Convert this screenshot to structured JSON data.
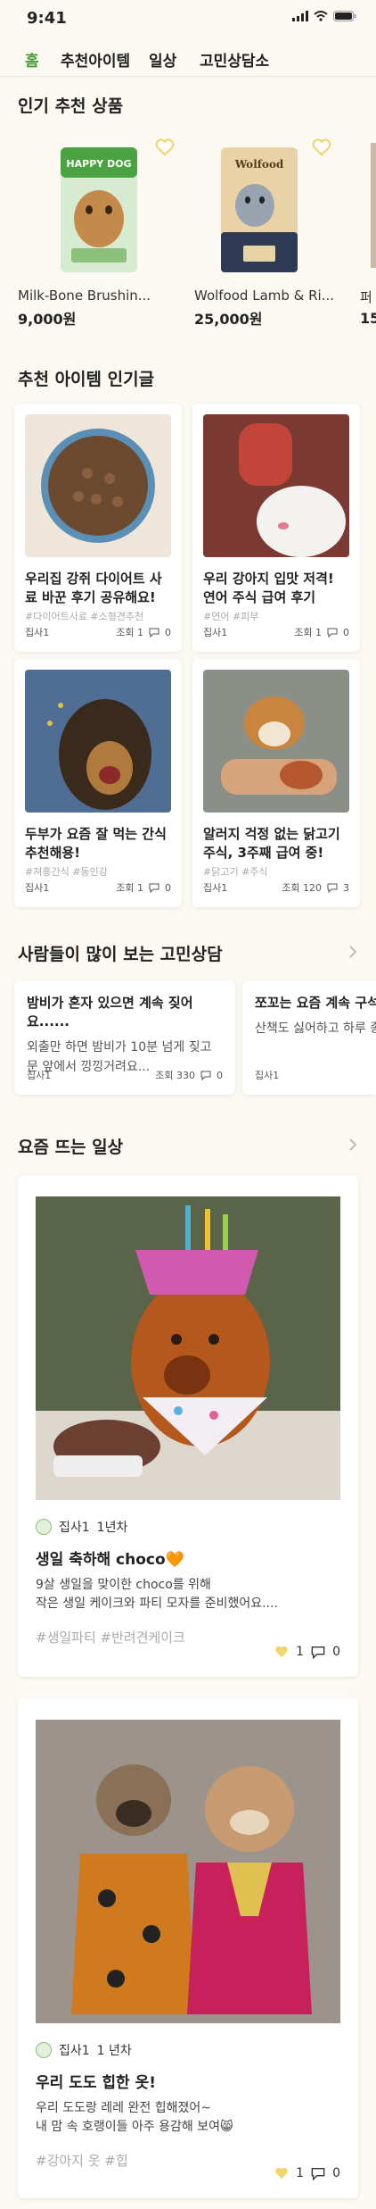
{
  "status_bar": {
    "time": "9:41"
  },
  "nav": {
    "tabs": [
      {
        "label": "홈",
        "active": true
      },
      {
        "label": "추천아이템",
        "active": false
      },
      {
        "label": "일상",
        "active": false
      },
      {
        "label": "고민상담소",
        "active": false
      }
    ]
  },
  "popular": {
    "title": "인기 추천 상품",
    "products": [
      {
        "name": "Milk-Bone Brushin...",
        "price": "9,000원",
        "img_text": "HAPPY DOG"
      },
      {
        "name": "Wolfood Lamb & Ri...",
        "price": "25,000원",
        "img_text": "Wolfood"
      },
      {
        "name": "퍼",
        "price": "15"
      }
    ]
  },
  "recommend": {
    "title": "추천 아이템 인기글",
    "posts": [
      {
        "title": "우리집 강쥐 다이어트 사료 바꾼 후기 공유해요!",
        "tags": "#다이어트사료 #소형견추천",
        "author": "집사1",
        "views": "조회 1",
        "comments": "0"
      },
      {
        "title": "우리 강아지 입맛 저격! 연어 주식 급여 후기",
        "tags": "#연어 #피부",
        "author": "집사1",
        "views": "조회 1",
        "comments": "0"
      },
      {
        "title": "두부가 요즘 잘 먹는 간식 추천해용!",
        "tags": "#져흥간식 #동인강",
        "author": "집사1",
        "views": "조회 1",
        "comments": "0"
      },
      {
        "title": "알러지 걱정 없는 닭고기 주식, 3주째 급여 중!",
        "tags": "#닭고기 #주식",
        "author": "집사1",
        "views": "조회 120",
        "comments": "3"
      }
    ]
  },
  "consult": {
    "title": "사람들이 많이 보는 고민상담",
    "posts": [
      {
        "title": "밤비가 혼자 있으면 계속 짖어요......",
        "body": "외출만 하면 밤비가 10분 넘게 짖고 문 앞에서 낑낑거려요...",
        "author": "집사1",
        "views": "조회 330",
        "comments": "0"
      },
      {
        "title": "쪼꼬는 요즘 계속 구석에",
        "body": "산책도 싫어하고 하루 종일 요...",
        "author": "집사1",
        "views": "",
        "comments": ""
      }
    ]
  },
  "daily": {
    "title": "요즘 뜨는 일상",
    "posts": [
      {
        "author": "집사1",
        "years": "1년차",
        "title": "생일 축하해 choco🧡",
        "body1": "9살 생일을 맞이한 choco를 위해",
        "body2": "작은 생일 케이크와 파티 모자를 준비했어요....",
        "tags": "#생일파티 #반려견케이크",
        "likes": "1",
        "comments": "0"
      },
      {
        "author": "집사1",
        "years": "1 년차",
        "title": "우리 도도 힙한 옷!",
        "body1": "우리 도도랑 레레 완전 힙해졌어~",
        "body2": "내 맘 속 호랭이들 아주 용감해 보여😸",
        "tags": "#강아지 옷 #힙",
        "likes": "1",
        "comments": "0"
      }
    ]
  },
  "colors": {
    "accent": "#4a9a3c",
    "heart": "#f3d36b",
    "background": "#fbf9f2"
  }
}
